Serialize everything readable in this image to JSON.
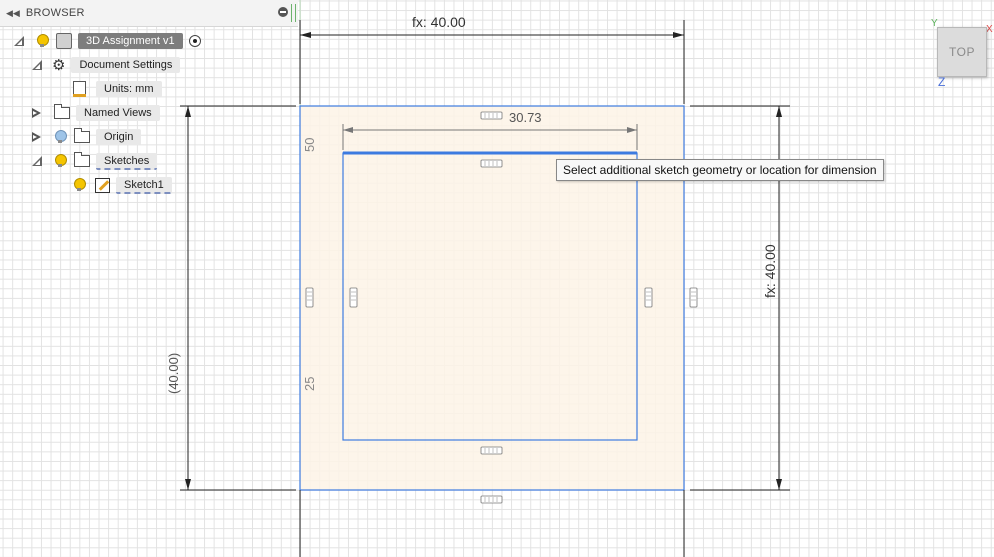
{
  "browser": {
    "title": "BROWSER",
    "collapse_glyph": "◀◀",
    "items": [
      {
        "label": "3D Assignment v1",
        "icon": "component-icon"
      },
      {
        "label": "Document Settings",
        "icon": "gear-icon"
      },
      {
        "label": "Units: mm",
        "icon": "document-icon"
      },
      {
        "label": "Named Views",
        "icon": "folder-icon"
      },
      {
        "label": "Origin",
        "icon": "folder-icon"
      },
      {
        "label": "Sketches",
        "icon": "folder-icon"
      },
      {
        "label": "Sketch1",
        "icon": "sketch-icon"
      }
    ]
  },
  "viewport": {
    "dim_top": "fx: 40.00",
    "dim_right": "fx: 40.00",
    "dim_left": "(40.00)",
    "dim_inner_width": "30.73",
    "dim_inner_top": "50",
    "dim_inner_bottom": "25",
    "tooltip": "Select additional sketch geometry or location for dimension"
  },
  "viewcube": {
    "face": "TOP",
    "axis_y": "Y",
    "axis_z": "Z",
    "axis_x": "X"
  },
  "colors": {
    "sketch_blue": "#3d7be0",
    "sketch_fill": "#fdf3e6",
    "dimension_line": "#222222"
  }
}
